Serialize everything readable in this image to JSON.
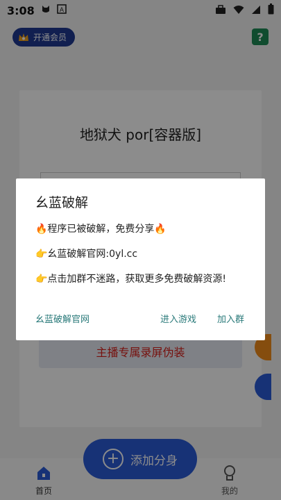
{
  "status_bar": {
    "time": "3:08",
    "icons": [
      "cat-icon",
      "a-box-icon",
      "briefcase-icon",
      "wifi-icon",
      "signal-icon",
      "battery-icon"
    ]
  },
  "header": {
    "vip_label": "开通会员",
    "help_label": "?"
  },
  "card": {
    "game_title": "地狱犬 por[容器版]",
    "record_button": "主播专属录屏伪装"
  },
  "add_button": {
    "label": "添加分身"
  },
  "tabbar": {
    "home": "首页",
    "mine": "我的"
  },
  "dialog": {
    "title": "幺蓝破解",
    "line1": "🔥程序已被破解，免费分享🔥",
    "line2": "👉幺蓝破解官网:0yl.cc",
    "line3": "👉点击加群不迷路，获取更多免费破解资源!",
    "action_site": "幺蓝破解官网",
    "action_game": "进入游戏",
    "action_group": "加入群"
  },
  "colors": {
    "accent_blue": "#2a5bd7",
    "vip_navy": "#1f3a93",
    "help_green": "#1e8a57",
    "record_red": "#d8201a",
    "dialog_action": "#2a7a7a"
  }
}
